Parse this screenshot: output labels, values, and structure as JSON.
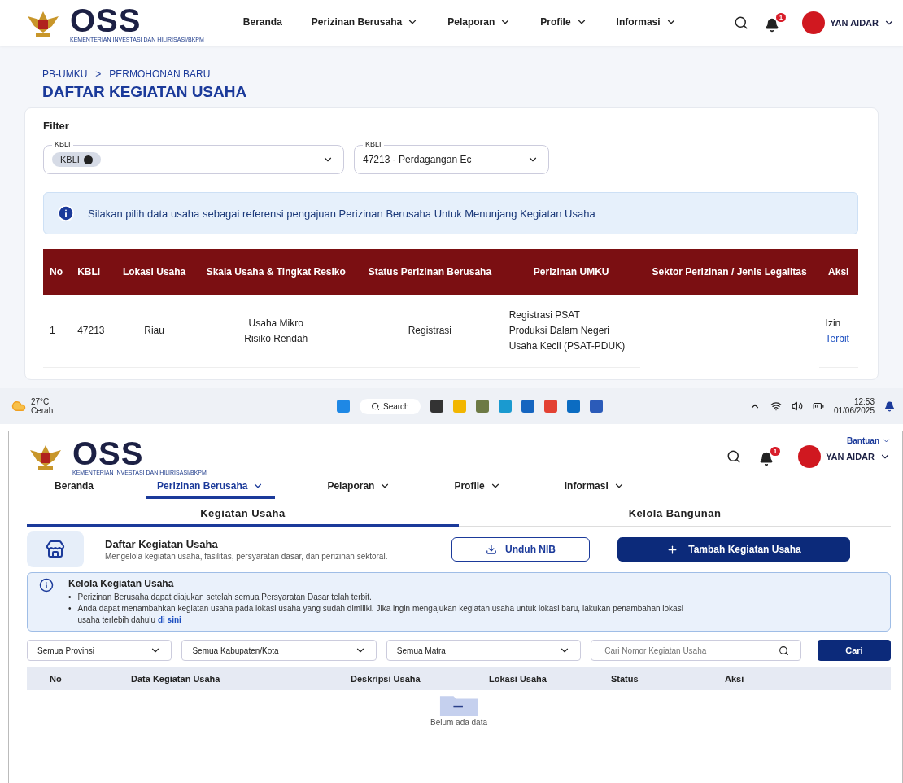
{
  "top_screen": {
    "header": {
      "logo_text": "OSS",
      "logo_subtitle": "KEMENTERIAN INVESTASI DAN HILIRISASI/BKPM",
      "nav": [
        {
          "label": "Beranda",
          "dropdown": false
        },
        {
          "label": "Perizinan Berusaha",
          "dropdown": true
        },
        {
          "label": "Pelaporan",
          "dropdown": true
        },
        {
          "label": "Profile",
          "dropdown": true
        },
        {
          "label": "Informasi",
          "dropdown": true
        }
      ],
      "notification_count": "1",
      "user": "YAN AIDAR"
    },
    "breadcrumb": [
      "PB-UMKU",
      ">",
      "PERMOHONAN BARU"
    ],
    "title": "DAFTAR KEGIATAN USAHA",
    "filter": {
      "title": "Filter",
      "fields": [
        {
          "label": "KBLI",
          "chip": "KBLI"
        },
        {
          "label": "KBLI",
          "value": "47213 - Perdagangan Ec"
        }
      ]
    },
    "info": "Silakan pilih data usaha sebagai referensi pengajuan Perizinan Berusaha Untuk Menunjang Kegiatan Usaha",
    "table": {
      "columns": [
        "No",
        "KBLI",
        "Lokasi Usaha",
        "Skala Usaha & Tingkat Resiko",
        "Status Perizinan Berusaha",
        "Perizinan UMKU",
        "Sektor Perizinan / Jenis Legalitas",
        "Aksi"
      ],
      "rows": [
        {
          "no": "1",
          "kbli": "47213",
          "lokasi": "Riau",
          "skala": [
            "Usaha Mikro",
            "Risiko Rendah"
          ],
          "status": "Registrasi",
          "umku": [
            "Registrasi PSAT",
            "Produksi Dalam Negeri",
            "Usaha Kecil (PSAT-PDUK)"
          ],
          "aksi_label": "Izin",
          "aksi_link": "Terbit"
        }
      ]
    }
  },
  "taskbar": {
    "temperature": "27°C",
    "weather": "Cerah",
    "search": "Search",
    "time": "12:53",
    "date": "01/06/2025"
  },
  "bottom_screen": {
    "help": "Bantuan",
    "header": {
      "logo_text": "OSS",
      "logo_subtitle": "KEMENTERIAN INVESTASI DAN HILIRISASI/BKPM",
      "notification_count": "1",
      "user": "YAN AIDAR"
    },
    "nav": [
      {
        "label": "Beranda",
        "dropdown": false,
        "selected": false
      },
      {
        "label": "Perizinan Berusaha",
        "dropdown": true,
        "selected": true
      },
      {
        "label": "Pelaporan",
        "dropdown": true,
        "selected": false
      },
      {
        "label": "Profile",
        "dropdown": true,
        "selected": false
      },
      {
        "label": "Informasi",
        "dropdown": true,
        "selected": false
      }
    ],
    "tabs": [
      {
        "label": "Kegiatan Usaha",
        "selected": true
      },
      {
        "label": "Kelola Bangunan",
        "selected": false
      }
    ],
    "card": {
      "title": "Daftar Kegiatan Usaha",
      "description": "Mengelola kegiatan usaha, fasilitas, persyaratan dasar, dan perizinan sektoral.",
      "download_button": "Unduh NIB",
      "add_button": "Tambah Kegiatan Usaha"
    },
    "info": {
      "title": "Kelola Kegiatan Usaha",
      "bullets": [
        {
          "marker": "•",
          "text": "Perizinan Berusaha dapat diajukan setelah semua Persyaratan Dasar telah terbit."
        },
        {
          "marker": "•",
          "text": "Anda dapat menambahkan kegiatan usaha pada lokasi usaha yang sudah dimiliki. Jika ingin mengajukan kegiatan usaha untuk lokasi baru, lakukan penambahan lokasi usaha terlebih dahulu",
          "link": "di sini"
        }
      ]
    },
    "filters": [
      "Semua Provinsi",
      "Semua Kabupaten/Kota",
      "Semua Matra"
    ],
    "search_placeholder": "Cari Nomor Kegiatan Usaha",
    "search_button": "Cari",
    "table": {
      "columns": [
        "No",
        "Data Kegiatan Usaha",
        "Deskripsi Usaha",
        "Lokasi Usaha",
        "Status",
        "Aksi"
      ],
      "empty": "Belum ada data"
    }
  }
}
